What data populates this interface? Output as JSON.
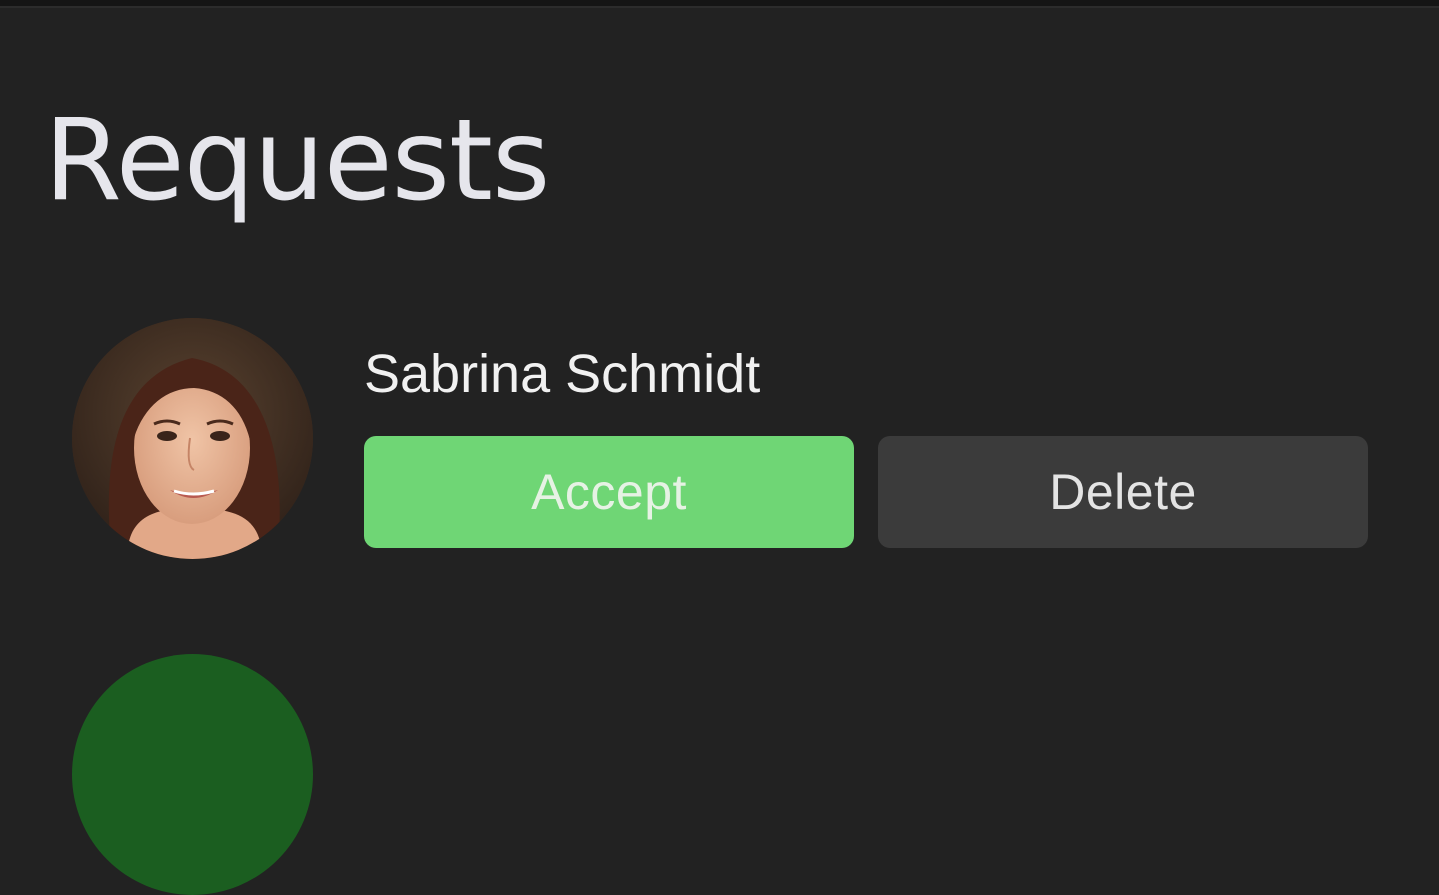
{
  "header": {
    "title": "Requests"
  },
  "requests": [
    {
      "name": "Sabrina Schmidt",
      "accept_label": "Accept",
      "delete_label": "Delete"
    }
  ],
  "colors": {
    "background": "#222222",
    "accept": "#6fd675",
    "delete": "#3b3b3b",
    "next_avatar": "#1b5e20"
  }
}
